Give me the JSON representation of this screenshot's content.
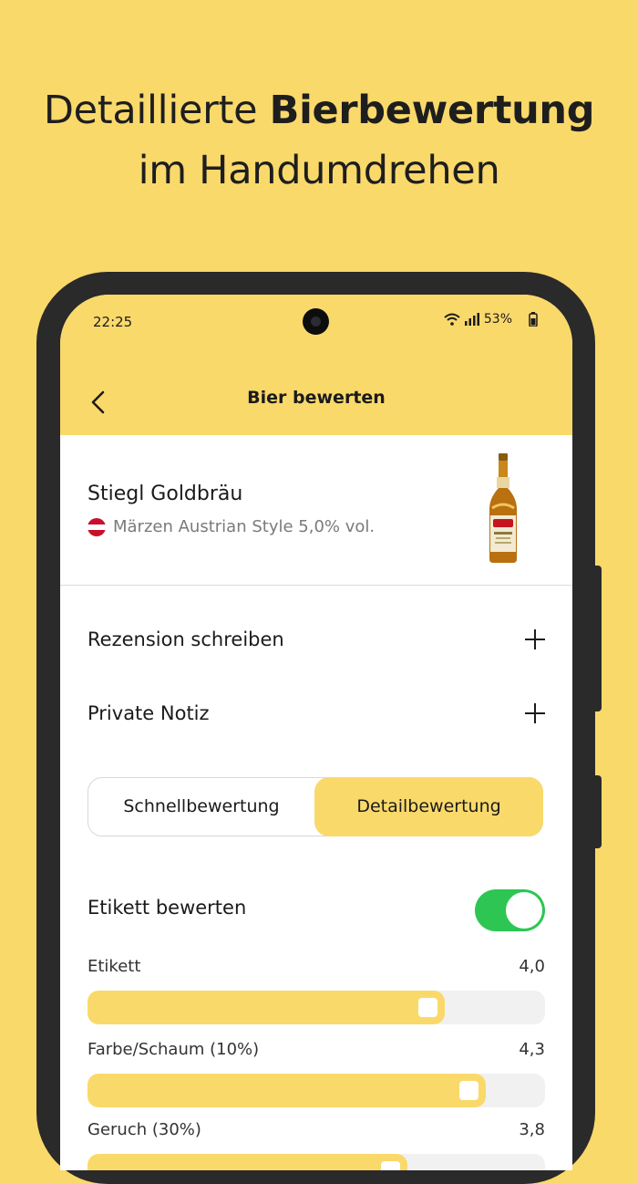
{
  "promo": {
    "line1_regular": "Detaillierte ",
    "line1_bold": "Bierbewertung",
    "line2": "im Handumdrehen"
  },
  "status_bar": {
    "time": "22:25",
    "battery": "53%",
    "icons": [
      "wifi-icon",
      "signal-icon",
      "battery-icon"
    ]
  },
  "header": {
    "title": "Bier bewerten",
    "back_icon": "chevron-left-icon"
  },
  "beer": {
    "name": "Stiegl Goldbräu",
    "meta": "Märzen Austrian Style 5,0% vol.",
    "flag": "austria-flag-icon"
  },
  "sections": {
    "review_label": "Rezension schreiben",
    "note_label": "Private Notiz"
  },
  "mode_tabs": {
    "quick": "Schnellbewertung",
    "detail": "Detailbewertung",
    "selected": "detail"
  },
  "label_rating": {
    "toggle_label": "Etikett bewerten",
    "enabled": true
  },
  "ratings": [
    {
      "label": "Etikett",
      "value": "4,0",
      "fraction": 0.78
    },
    {
      "label": "Farbe/Schaum (10%)",
      "value": "4,3",
      "fraction": 0.87
    },
    {
      "label": "Geruch (30%)",
      "value": "3,8",
      "fraction": 0.7
    }
  ],
  "colors": {
    "accent": "#FAD96B",
    "toggle_on": "#2DC653"
  }
}
